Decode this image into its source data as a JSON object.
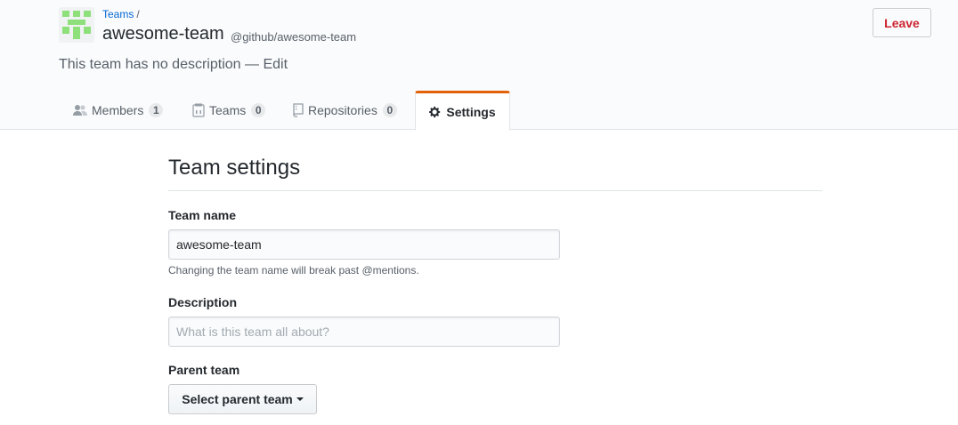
{
  "header": {
    "breadcrumb_link": "Teams",
    "breadcrumb_separator": "/",
    "team_name": "awesome-team",
    "team_handle": "@github/awesome-team",
    "description_text": "This team has no description —",
    "description_edit": "Edit",
    "leave_label": "Leave"
  },
  "tabs": [
    {
      "label": "Members",
      "count": "1",
      "icon": "people-icon"
    },
    {
      "label": "Teams",
      "count": "0",
      "icon": "teams-icon"
    },
    {
      "label": "Repositories",
      "count": "0",
      "icon": "repo-icon"
    },
    {
      "label": "Settings",
      "icon": "gear-icon",
      "active": true
    }
  ],
  "settings": {
    "title": "Team settings",
    "name_label": "Team name",
    "name_value": "awesome-team",
    "name_note": "Changing the team name will break past @mentions.",
    "description_label": "Description",
    "description_placeholder": "What is this team all about?",
    "parent_label": "Parent team",
    "parent_button": "Select parent team"
  },
  "colors": {
    "accent_tab": "#e36209",
    "link": "#0366d6",
    "danger": "#cb2431",
    "avatar": "#8ee07a"
  }
}
